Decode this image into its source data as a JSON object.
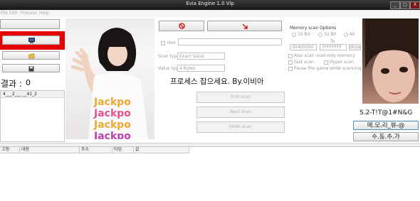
{
  "window": {
    "title": "Evia Engine 1.0 Vip",
    "minimize": "_",
    "maximize": "□",
    "close": "X"
  },
  "menu": [
    "File",
    "Edit",
    "Process",
    "Help"
  ],
  "left_panel": {
    "result_label": "결과 :",
    "result_count": "0",
    "list_row": "4___2___   __41_2",
    "icons": {
      "process": "computer-icon",
      "open": "folder-open-icon",
      "save": "floppy-disk-icon"
    },
    "highlight_color": "#e00000"
  },
  "scan": {
    "new_scan_icon": "no-entry-icon",
    "next_scan_icon": "red-arrow-icon",
    "hex_label": "Hex",
    "scan_type_label": "Scan type",
    "scan_type_value": "Exact Value",
    "value_type_label": "Value type",
    "value_type_value": "4 Bytes",
    "message": "프로세스 잡으세요. By.이비아",
    "first_scan": "First scan",
    "next_scan": "Next scan",
    "undo_scan": "Undo scan"
  },
  "options": {
    "title": "Memory scan Options",
    "bits": [
      "16 Bit",
      "32 Bit",
      "All"
    ],
    "from": "00400000",
    "to_label": "To",
    "to": "7FFFFFFF",
    "show": "Show",
    "checkboxes": [
      "Also scan read-only memory",
      "Fast scan",
      "Pause the game while scanning"
    ],
    "hyper": "Hyper scan"
  },
  "right_panel": {
    "id_text": "S.2-T!T@1#N&G",
    "memory_view_button": "메.모.리_뷰-@",
    "add_manual_button": "수.동.추.가"
  },
  "table": {
    "headers": [
      "고정",
      "내용",
      "주소",
      "타입",
      "값"
    ]
  }
}
